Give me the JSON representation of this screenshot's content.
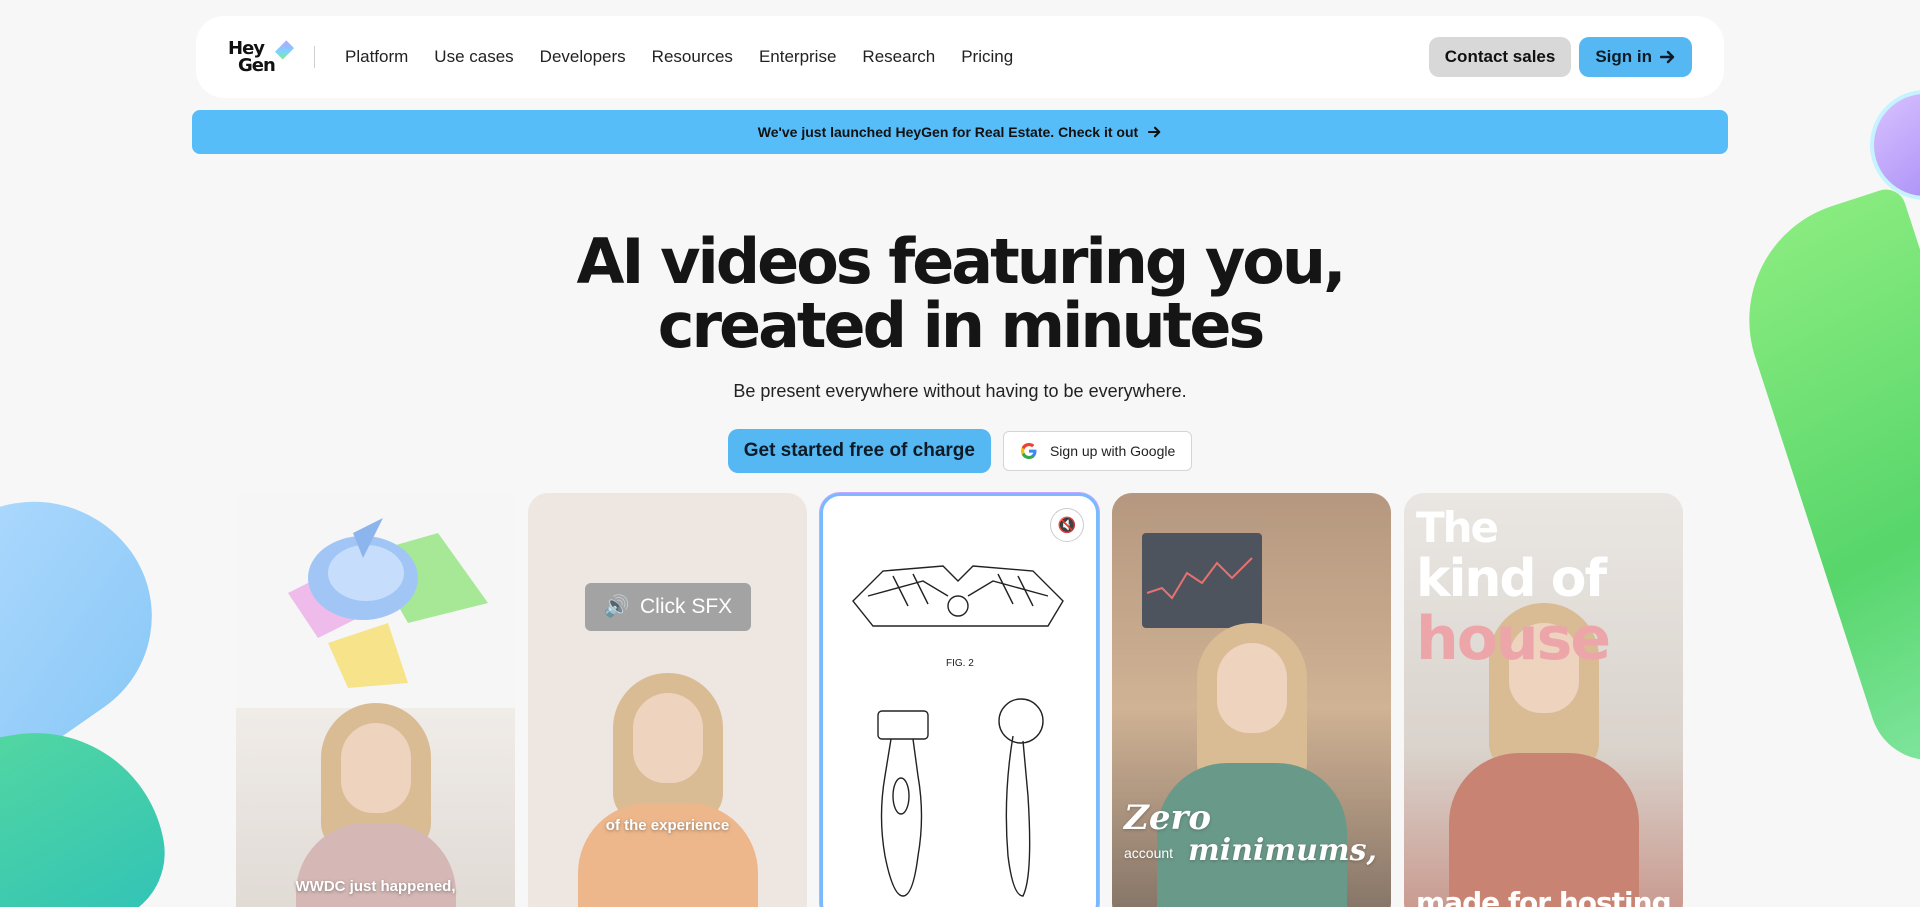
{
  "nav": {
    "logo_top": "Hey",
    "logo_bottom": "Gen",
    "links": [
      "Platform",
      "Use cases",
      "Developers",
      "Resources",
      "Enterprise",
      "Research",
      "Pricing"
    ],
    "contact_label": "Contact sales",
    "signin_label": "Sign in",
    "signin_icon": "arrow-right-icon"
  },
  "banner": {
    "text": "We've just launched HeyGen for Real Estate. Check it out",
    "icon": "arrow-right-icon"
  },
  "hero": {
    "title_line1": "AI videos featuring you,",
    "title_line2": "created in minutes",
    "subtitle": "Be present everywhere without having to be everywhere.",
    "cta_primary": "Get started free of charge",
    "cta_google": "Sign up with Google",
    "google_icon": "google-icon"
  },
  "cards": {
    "card1_caption": "WWDC just happened,",
    "card2_badge": "Click SFX",
    "card2_caption": "of the experience",
    "card3_mute_icon": "mute-icon",
    "card3_fig": "FIG. 2",
    "card4_line1": "Zero",
    "card4_small": "account",
    "card4_line2": "minimums,",
    "card5_line1": "The",
    "card5_line2": "kind of",
    "card5_line3": "house",
    "card5_caption": "made for hosting"
  },
  "colors": {
    "accent": "#57bdf8",
    "background": "#f7f7f7",
    "text": "#151515"
  }
}
